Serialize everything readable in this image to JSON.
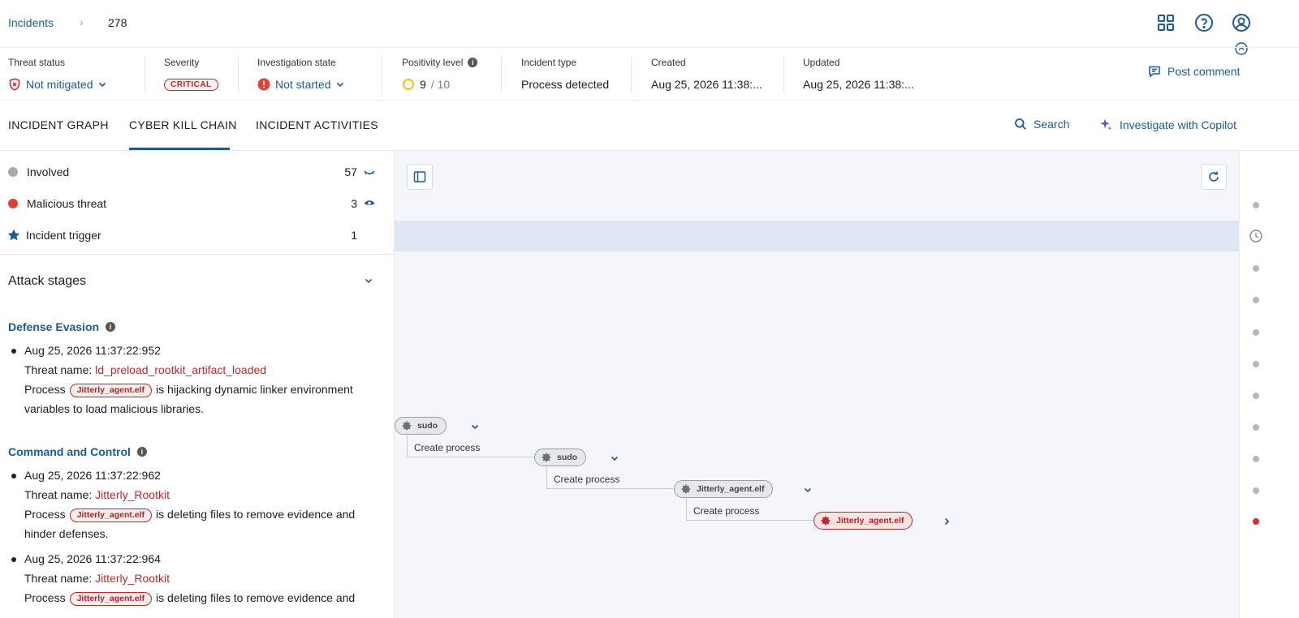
{
  "breadcrumb": {
    "root": "Incidents",
    "separator": "›",
    "incident_id": "278"
  },
  "header_icons": [
    "grid-icon",
    "help-icon",
    "user-icon"
  ],
  "status": {
    "threat_status": {
      "label": "Threat status",
      "value": "Not mitigated"
    },
    "severity": {
      "label": "Severity",
      "value": "CRITICAL"
    },
    "investigation_state": {
      "label": "Investigation state",
      "value": "Not started"
    },
    "positivity_level": {
      "label": "Positivity level",
      "value": "9",
      "max": "/ 10"
    },
    "incident_type": {
      "label": "Incident type",
      "value": "Process detected"
    },
    "created": {
      "label": "Created",
      "value": "Aug 25, 2026 11:38:..."
    },
    "updated": {
      "label": "Updated",
      "value": "Aug 25, 2026 11:38:..."
    },
    "post_comment": "Post comment"
  },
  "tabs": {
    "items": [
      {
        "label": "INCIDENT GRAPH"
      },
      {
        "label": "CYBER KILL CHAIN"
      },
      {
        "label": "INCIDENT ACTIVITIES"
      }
    ],
    "active": "CYBER KILL CHAIN",
    "search": "Search",
    "copilot": "Investigate with Copilot"
  },
  "legend": [
    {
      "label": "Involved",
      "count": "57",
      "color": "#a7abb1"
    },
    {
      "label": "Malicious threat",
      "count": "3",
      "color": "#e0413b"
    },
    {
      "label": "Incident trigger",
      "count": "1",
      "color": "#1d5a98"
    }
  ],
  "attack_stages": {
    "title": "Attack stages",
    "stages": [
      {
        "name": "Defense Evasion",
        "events": [
          {
            "timestamp": "Aug 25, 2026 11:37:22:952",
            "threat_label": "Threat name:",
            "threat_name": "ld_preload_rootkit_artifact_loaded",
            "process_label": "Process",
            "process": "Jitterly_agent.elf",
            "description_1": "is hijacking dynamic linker environment",
            "description_2": "variables to load malicious libraries."
          }
        ]
      },
      {
        "name": "Command and Control",
        "events": [
          {
            "timestamp": "Aug 25, 2026 11:37:22:962",
            "threat_label": "Threat name:",
            "threat_name": "Jitterly_Rootkit",
            "process_label": "Process",
            "process": "Jitterly_agent.elf",
            "description_1": "is deleting files to remove evidence and",
            "description_2": "hinder defenses."
          },
          {
            "timestamp": "Aug 25, 2026 11:37:22:964",
            "threat_label": "Threat name:",
            "threat_name": "Jitterly_Rootkit",
            "process_label": "Process",
            "process": "Jitterly_agent.elf",
            "description_1": "is deleting files to remove evidence and"
          }
        ]
      }
    ]
  },
  "graph": {
    "nodes": [
      {
        "label": "sudo",
        "kind": "involved"
      },
      {
        "label": "sudo",
        "kind": "involved"
      },
      {
        "label": "Jitterly_agent.elf",
        "kind": "involved"
      },
      {
        "label": "Jitterly_agent.elf",
        "kind": "malicious"
      }
    ],
    "edges": [
      {
        "label": "Create process"
      },
      {
        "label": "Create process"
      },
      {
        "label": "Create process"
      }
    ]
  }
}
